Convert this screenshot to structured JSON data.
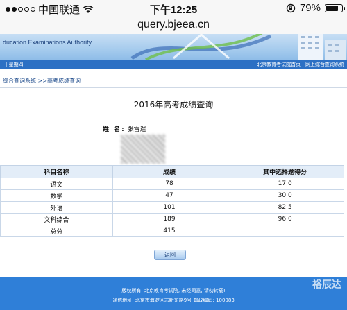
{
  "status_bar": {
    "carrier": "中国联通",
    "time": "下午12:25",
    "battery_text": "79%",
    "battery_level": 0.79,
    "signal_icon": "signal-dots-icon",
    "wifi_icon": "wifi-icon",
    "rotation_lock_icon": "rotation-lock-icon"
  },
  "browser": {
    "url": "query.bjeea.cn"
  },
  "site": {
    "banner_title": "ducation Examinations Authority",
    "weekday": "| 星期四",
    "top_links": "北京教育考试院首页 | 网上综合查询系统",
    "breadcrumb": "综合查询系统 >>高考成绩查询"
  },
  "page": {
    "title": "2016年高考成绩查询",
    "name_label": "姓 名:",
    "name_value": "张雪逞"
  },
  "score_table": {
    "headers": [
      "科目名称",
      "成绩",
      "其中选择题得分"
    ],
    "rows": [
      [
        "语文",
        "78",
        "17.0"
      ],
      [
        "数学",
        "47",
        "30.0"
      ],
      [
        "外语",
        "101",
        "82.5"
      ],
      [
        "文科综合",
        "189",
        "96.0"
      ],
      [
        "总分",
        "415",
        ""
      ]
    ]
  },
  "actions": {
    "back_label": "返回"
  },
  "footer": {
    "line1": "版权所有: 北京教育考试院, 未经同意, 请勿转载!",
    "line2": "通信地址: 北京市海淀区志新东路9号 邮政编码: 100083",
    "watermark": "裕辰达"
  },
  "colors": {
    "nav_blue": "#2c70c4",
    "footer_blue": "#2f7fd8",
    "table_header_bg": "#e3edf8"
  }
}
